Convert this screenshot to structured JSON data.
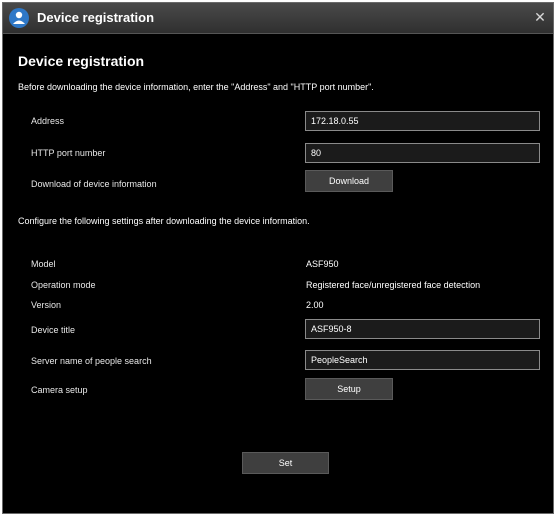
{
  "window": {
    "title": "Device registration",
    "close_icon": "close-icon"
  },
  "section1": {
    "heading": "Device registration",
    "description": "Before downloading the device information, enter the \"Address\" and \"HTTP port number\".",
    "address_label": "Address",
    "address_value": "172.18.0.55",
    "port_label": "HTTP port number",
    "port_value": "80",
    "download_label": "Download of device information",
    "download_button": "Download"
  },
  "section2": {
    "description": "Configure the following settings after downloading the device information.",
    "model_label": "Model",
    "model_value": "ASF950",
    "mode_label": "Operation mode",
    "mode_value": "Registered face/unregistered face detection",
    "version_label": "Version",
    "version_value": "2.00",
    "title_label": "Device title",
    "title_value": "ASF950-8",
    "server_label": "Server name of people search",
    "server_value": "PeopleSearch",
    "camera_label": "Camera setup",
    "setup_button": "Setup"
  },
  "footer": {
    "set_button": "Set"
  }
}
